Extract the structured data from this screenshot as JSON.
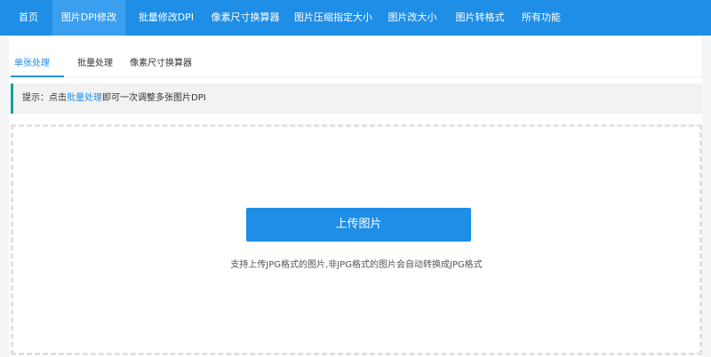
{
  "topnav": {
    "items": [
      {
        "label": "首页",
        "active": false
      },
      {
        "label": "图片DPI修改",
        "active": true
      },
      {
        "label": "批量修改DPI",
        "active": false
      },
      {
        "label": "像素尺寸换算器",
        "active": false
      },
      {
        "label": "图片压缩指定大小",
        "active": false
      },
      {
        "label": "图片改大小",
        "active": false
      },
      {
        "label": "图片转格式",
        "active": false
      },
      {
        "label": "所有功能",
        "active": false
      }
    ]
  },
  "subtabs": {
    "items": [
      {
        "label": "单张处理",
        "active": true
      },
      {
        "label": "批量处理",
        "active": false
      },
      {
        "label": "像素尺寸换算器",
        "active": false
      }
    ]
  },
  "tip": {
    "prefix": "提示：点击",
    "link": "批量处理",
    "suffix": "即可一次调整多张图片DPI"
  },
  "upload": {
    "button_label": "上传图片",
    "note": "支持上传JPG格式的图片,非JPG格式的图片会自动转换成JPG格式"
  },
  "colors": {
    "nav_bg": "#1e8ee6",
    "nav_active": "#3a9fef",
    "tip_border": "#1aa094",
    "button_bg": "#1e8ee6"
  }
}
